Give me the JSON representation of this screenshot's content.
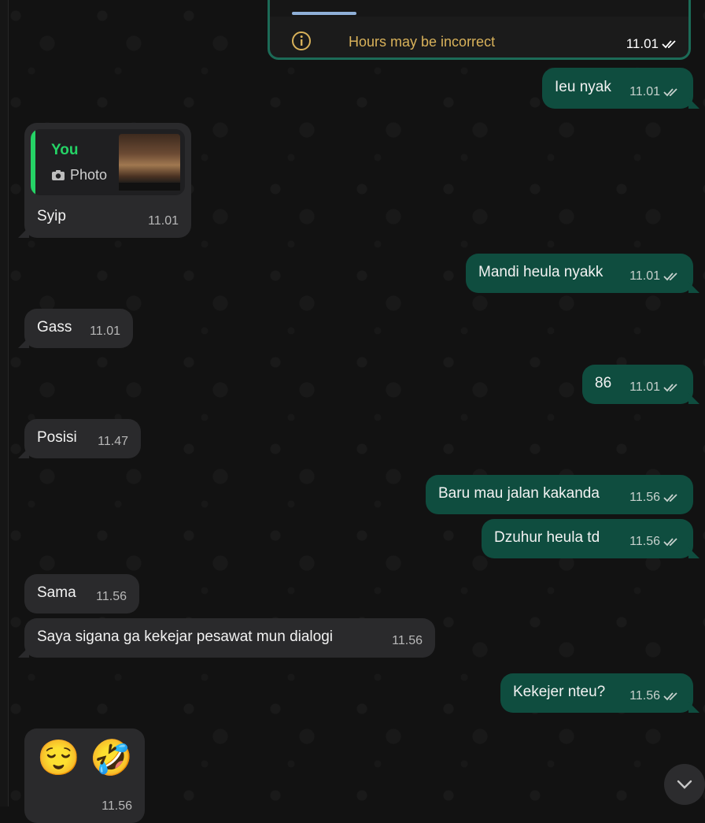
{
  "top_card": {
    "notice": "Hours may be incorrect",
    "time": "11.01"
  },
  "reply_card": {
    "author": "You",
    "attachment_label": "Photo"
  },
  "messages": [
    {
      "id": "m1",
      "dir": "out",
      "text": "Ieu nyak",
      "time": "11.01"
    },
    {
      "id": "m2",
      "dir": "in",
      "text": "Syip",
      "time": "11.01"
    },
    {
      "id": "m3",
      "dir": "out",
      "text": "Mandi heula nyakk",
      "time": "11.01"
    },
    {
      "id": "m4",
      "dir": "in",
      "text": "Gass",
      "time": "11.01"
    },
    {
      "id": "m5",
      "dir": "out",
      "text": "86",
      "time": "11.01"
    },
    {
      "id": "m6",
      "dir": "in",
      "text": "Posisi",
      "time": "11.47"
    },
    {
      "id": "m7",
      "dir": "out",
      "text": "Baru mau jalan kakanda",
      "time": "11.56"
    },
    {
      "id": "m8",
      "dir": "out",
      "text": "Dzuhur heula td",
      "time": "11.56"
    },
    {
      "id": "m9",
      "dir": "in",
      "text": "Sama",
      "time": "11.56"
    },
    {
      "id": "m10",
      "dir": "in",
      "text": "Saya sigana ga kekejar pesawat mun dialogi",
      "time": "11.56"
    },
    {
      "id": "m11",
      "dir": "out",
      "text": "Kekejer nteu?",
      "time": "11.56"
    },
    {
      "id": "m12",
      "dir": "in",
      "text": "😌 🤣",
      "time": "11.56"
    }
  ],
  "colors": {
    "incoming_bubble": "#2a2a2c",
    "outgoing_bubble": "#0f4d3f",
    "accent_green": "#25d366",
    "notice_text": "#d9b25a"
  },
  "icons": {
    "read_receipt": "double-check-icon",
    "info": "info-icon",
    "camera": "camera-icon",
    "scroll_down": "chevron-down-icon"
  }
}
